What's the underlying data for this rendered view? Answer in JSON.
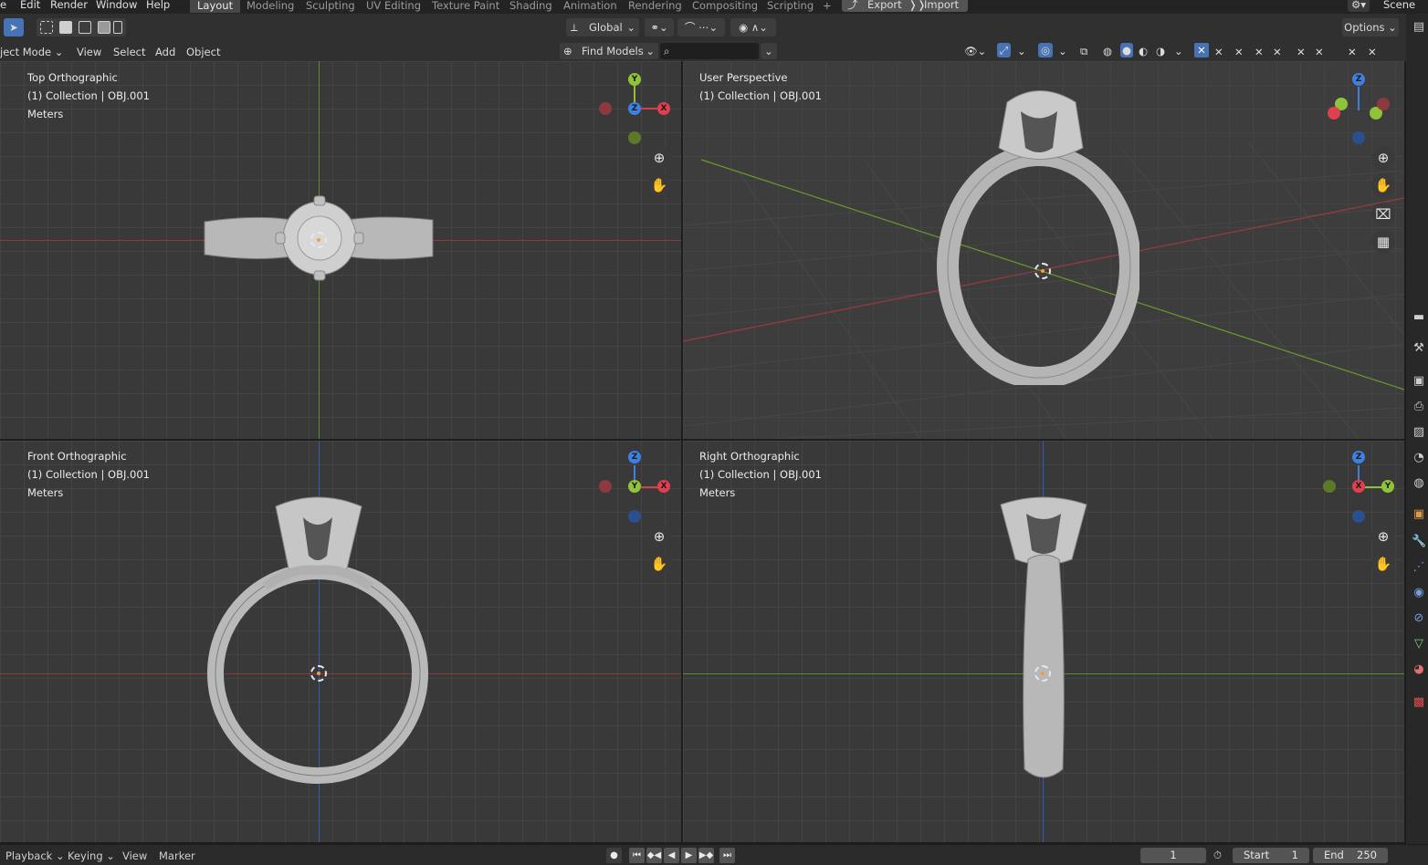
{
  "menu": {
    "file_partial": "e",
    "edit": "Edit",
    "render": "Render",
    "window": "Window",
    "help": "Help"
  },
  "workspaces": [
    "Layout",
    "Modeling",
    "Sculpting",
    "UV Editing",
    "Texture Paint",
    "Shading",
    "Animation",
    "Rendering",
    "Compositing",
    "Scripting"
  ],
  "add_tab": "+",
  "export_label": "Export",
  "import_label": "Import",
  "scene_label": "Scene",
  "toolbar": {
    "transform_orientation": "Global",
    "find_models": "Find Models",
    "options": "Options"
  },
  "viewport_header": {
    "mode": "ject Mode",
    "view": "View",
    "select": "Select",
    "add": "Add",
    "object": "Object"
  },
  "viewports": [
    {
      "view_name": "Top Orthographic",
      "collection": "(1) Collection | OBJ.001",
      "units": "Meters",
      "gizmo": {
        "up": "Y",
        "center": "Z",
        "right": "X"
      }
    },
    {
      "view_name": "User Perspective",
      "collection": "(1) Collection | OBJ.001",
      "units": "",
      "gizmo": {
        "up": "Z",
        "center": "",
        "right": ""
      }
    },
    {
      "view_name": "Front Orthographic",
      "collection": "(1) Collection | OBJ.001",
      "units": "Meters",
      "gizmo": {
        "up": "Z",
        "center": "Y",
        "right": "X"
      }
    },
    {
      "view_name": "Right Orthographic",
      "collection": "(1) Collection | OBJ.001",
      "units": "Meters",
      "gizmo": {
        "up": "Z",
        "center": "X",
        "right": "Y"
      }
    }
  ],
  "timeline": {
    "playback": "Playback",
    "keying": "Keying",
    "view": "View",
    "marker": "Marker",
    "current_frame": "1",
    "start_label": "Start",
    "start_value": "1",
    "end_label": "End",
    "end_value": "250"
  },
  "colors": {
    "x_axis": "#c8454f",
    "y_axis": "#7fb82e",
    "z_axis": "#3f7fe0",
    "accent": "#4772b3",
    "background": "#393939"
  }
}
